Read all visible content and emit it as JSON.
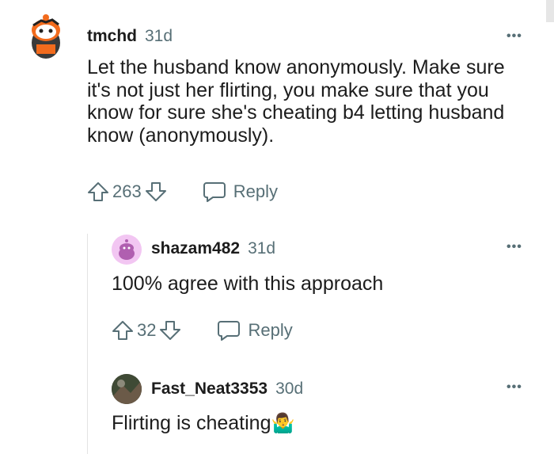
{
  "comments": [
    {
      "username": "tmchd",
      "time": "31d",
      "body": "Let the husband know anonymously. Make sure it's not just her flirting, you make sure that you know for sure she's cheating b4 letting husband know (anonymously).",
      "votes": "263",
      "reply_label": "Reply",
      "more": "•••"
    },
    {
      "username": "shazam482",
      "time": "31d",
      "body": "100% agree with this approach",
      "votes": "32",
      "reply_label": "Reply",
      "more": "•••"
    },
    {
      "username": "Fast_Neat3353",
      "time": "30d",
      "body": "Flirting is cheating",
      "emoji": "🤷‍♂️",
      "more": "•••"
    }
  ],
  "colors": {
    "text": "#1c1c1c",
    "meta": "#576f76",
    "thread_line": "#e3e3e3",
    "avatar2_bg": "#f2c6f2"
  }
}
